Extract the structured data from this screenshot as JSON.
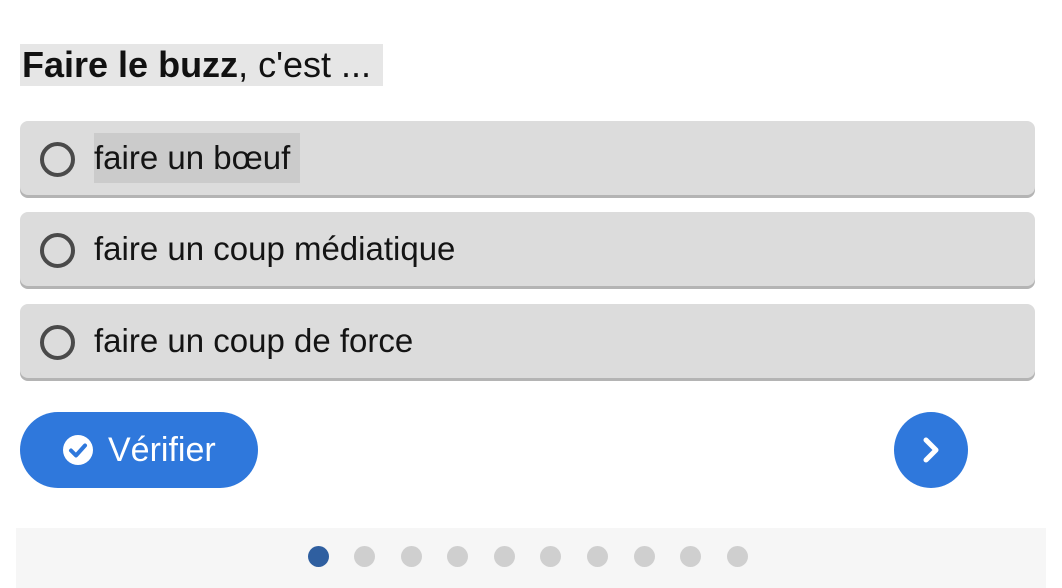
{
  "question": {
    "bold": "Faire le buzz",
    "rest": ", c'est ..."
  },
  "options": [
    {
      "label": "faire un bœuf",
      "highlighted": true
    },
    {
      "label": "faire un coup médiatique",
      "highlighted": false
    },
    {
      "label": "faire un coup de force",
      "highlighted": false
    }
  ],
  "verify_button": {
    "label": "Vérifier",
    "icon": "check-circle-icon"
  },
  "next_button": {
    "icon": "chevron-right-icon"
  },
  "pager": {
    "total": 10,
    "current": 1
  },
  "colors": {
    "accent": "#2f78dc",
    "option_bg": "#dcdcdc",
    "active_dot": "#2f5fa0",
    "inactive_dot": "#cfcfcf"
  }
}
